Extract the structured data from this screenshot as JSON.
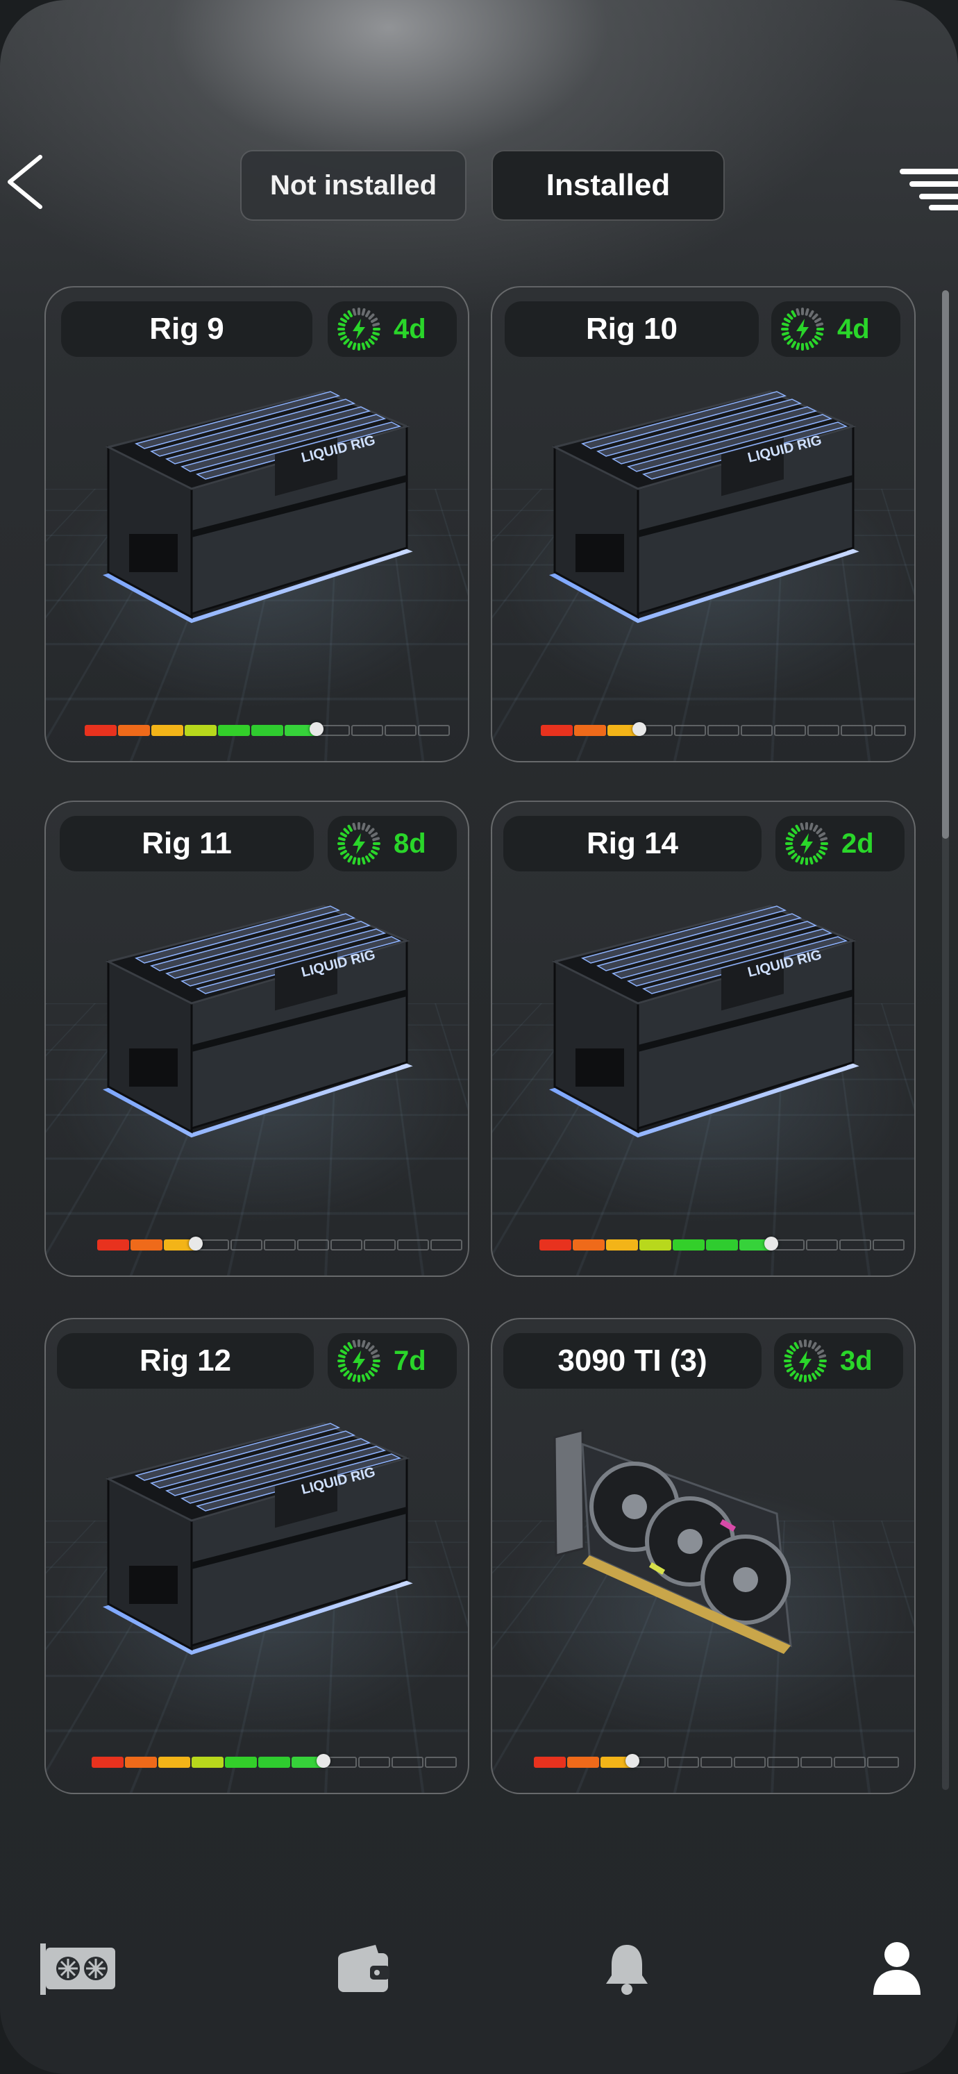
{
  "header": {
    "tabs": [
      {
        "label": "Not installed",
        "active": false
      },
      {
        "label": "Installed",
        "active": true
      }
    ]
  },
  "cards": [
    {
      "title": "Rig 9",
      "timer": "4d",
      "type": "rig",
      "level": 7,
      "max_level": 11
    },
    {
      "title": "Rig 10",
      "timer": "4d",
      "type": "rig",
      "level": 3,
      "max_level": 11
    },
    {
      "title": "Rig 11",
      "timer": "8d",
      "type": "rig",
      "level": 3,
      "max_level": 11
    },
    {
      "title": "Rig 14",
      "timer": "2d",
      "type": "rig",
      "level": 7,
      "max_level": 11
    },
    {
      "title": "Rig 12",
      "timer": "7d",
      "type": "rig",
      "level": 7,
      "max_level": 11
    },
    {
      "title": "3090 TI (3)",
      "timer": "3d",
      "type": "gpu",
      "level": 3,
      "max_level": 11
    }
  ],
  "rig_label": "LIQUID RIG",
  "level_colors": [
    "#e8321e",
    "#ef6a1a",
    "#f3b418",
    "#b8d81c",
    "#33cf2a",
    "#2fcc2f",
    "#36d23a"
  ],
  "timer_color": "#2ad62a",
  "nav": [
    {
      "icon": "gpu-card-icon",
      "active": false
    },
    {
      "icon": "wallet-icon",
      "active": false
    },
    {
      "icon": "bell-icon",
      "active": false
    },
    {
      "icon": "user-icon",
      "active": true
    }
  ]
}
